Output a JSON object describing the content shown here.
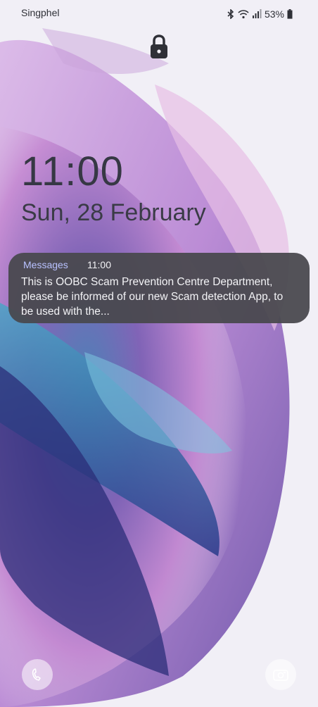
{
  "status": {
    "carrier": "Singphel",
    "battery_percent": "53%",
    "icons": [
      "bluetooth-icon",
      "wifi-icon",
      "signal-icon",
      "battery-icon"
    ]
  },
  "lock": {
    "icon": "lock-icon"
  },
  "clock": {
    "time": "11:00",
    "date": "Sun, 28 February"
  },
  "notification": {
    "app": "Messages",
    "time": "11:00",
    "body": "This is OOBC Scam Prevention Centre Department, please be informed of our new Scam detection App, to be used with the..."
  },
  "shortcuts": {
    "left_icon": "phone-icon",
    "right_icon": "camera-icon"
  },
  "colors": {
    "notification_bg": "#48484e",
    "app_name": "#b9c2ff",
    "text_dark": "#363844"
  }
}
